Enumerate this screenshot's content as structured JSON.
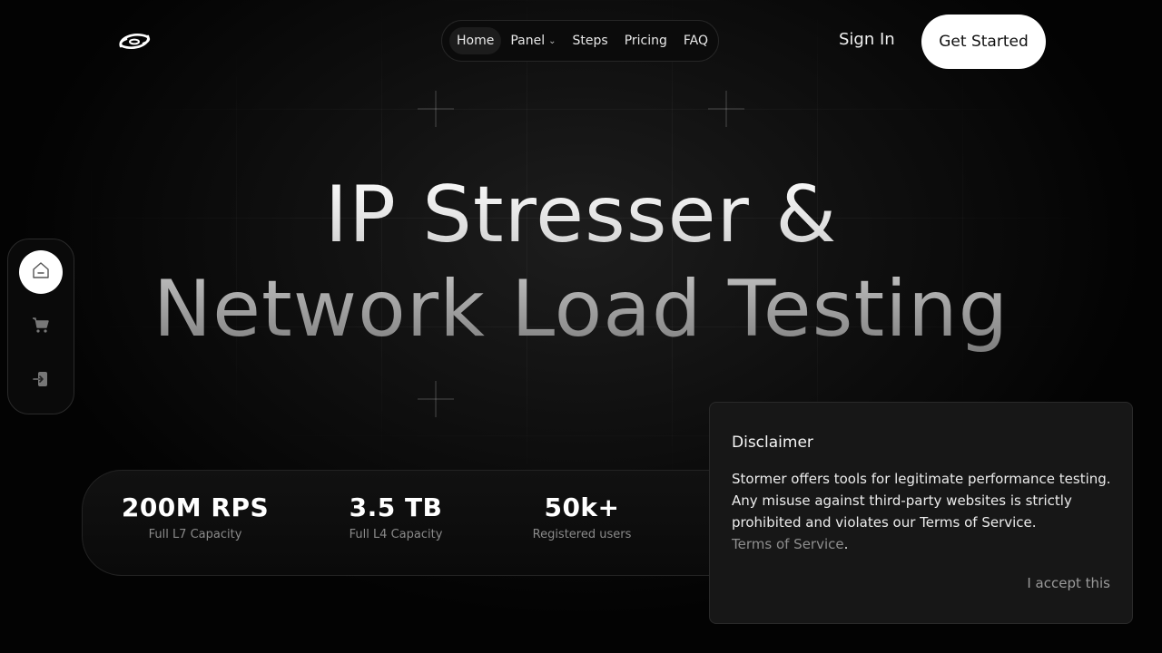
{
  "nav": {
    "items": [
      {
        "label": "Home",
        "active": true
      },
      {
        "label": "Panel",
        "dropdown": true
      },
      {
        "label": "Steps"
      },
      {
        "label": "Pricing"
      },
      {
        "label": "FAQ"
      }
    ],
    "sign_in": "Sign In",
    "get_started": "Get Started"
  },
  "hero": {
    "line1": "IP Stresser &",
    "line2": "Network Load Testing"
  },
  "dock": {
    "icons": [
      "home-icon",
      "cart-icon",
      "login-icon"
    ]
  },
  "stats": [
    {
      "value": "200M RPS",
      "label": "Full L7 Capacity"
    },
    {
      "value": "3.5 TB",
      "label": "Full L4 Capacity"
    },
    {
      "value": "50k+",
      "label": "Registered users"
    }
  ],
  "disclaimer": {
    "title": "Disclaimer",
    "body": "Stormer offers tools for legitimate performance testing. Any misuse against third-party websites is strictly prohibited and violates our Terms of Service.",
    "link": "Terms of Service",
    "link_suffix": ".",
    "accept": "I accept this"
  },
  "colors": {
    "background": "#030303",
    "accent": "#ffffff",
    "panel": "#171717",
    "muted_text": "#8a8a8a"
  }
}
